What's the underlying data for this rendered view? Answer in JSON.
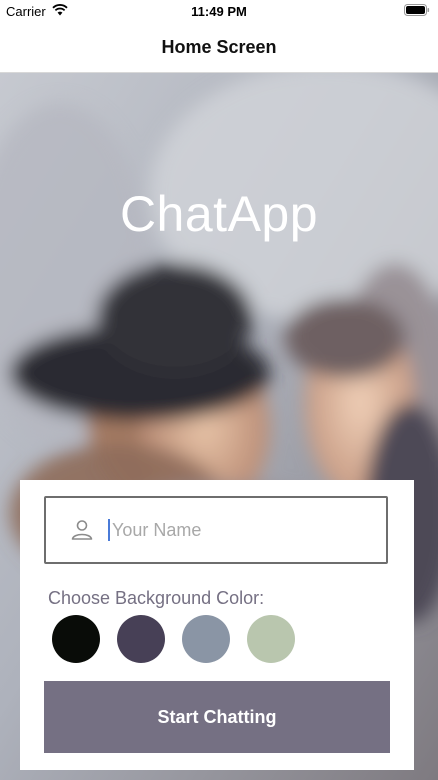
{
  "status_bar": {
    "carrier": "Carrier",
    "time": "11:49 PM"
  },
  "nav": {
    "title": "Home Screen"
  },
  "hero": {
    "app_title": "ChatApp"
  },
  "form": {
    "name_placeholder": "Your Name",
    "name_value": "",
    "choose_label": "Choose Background Color:",
    "colors": [
      {
        "name": "black",
        "hex": "#090C08"
      },
      {
        "name": "purple",
        "hex": "#474056"
      },
      {
        "name": "grey-blue",
        "hex": "#8A95A5"
      },
      {
        "name": "green",
        "hex": "#B9C6AE"
      }
    ],
    "start_label": "Start Chatting",
    "button_color": "#757083"
  },
  "icons": {
    "wifi": "wifi-icon",
    "battery": "battery-icon",
    "user": "user-icon"
  }
}
